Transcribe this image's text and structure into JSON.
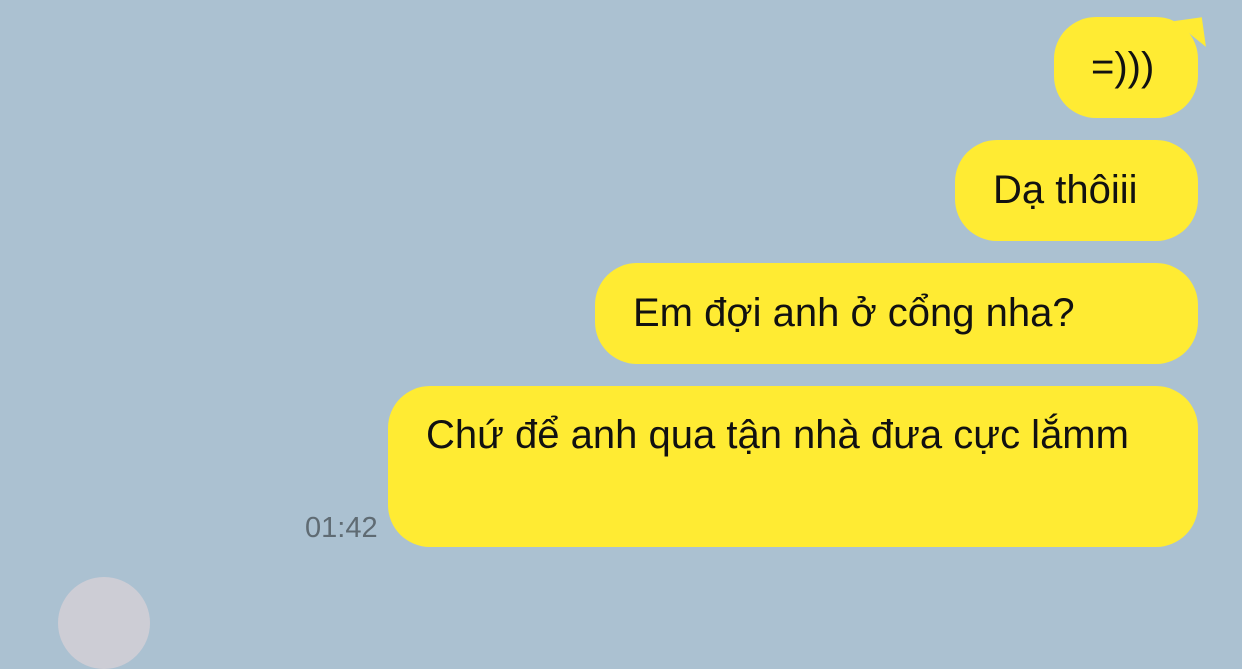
{
  "messages": [
    {
      "text": "=)))",
      "side": "sent"
    },
    {
      "text": "Dạ thôiii",
      "side": "sent"
    },
    {
      "text": "Em đợi anh ở cổng nha?",
      "side": "sent"
    },
    {
      "text": "Chứ để anh qua tận nhà đưa cực lắmm",
      "side": "sent"
    }
  ],
  "timestamp": "01:42",
  "colors": {
    "background": "#abc1d1",
    "sent_bubble": "#ffeb33",
    "timestamp_text": "#5f6b73"
  }
}
